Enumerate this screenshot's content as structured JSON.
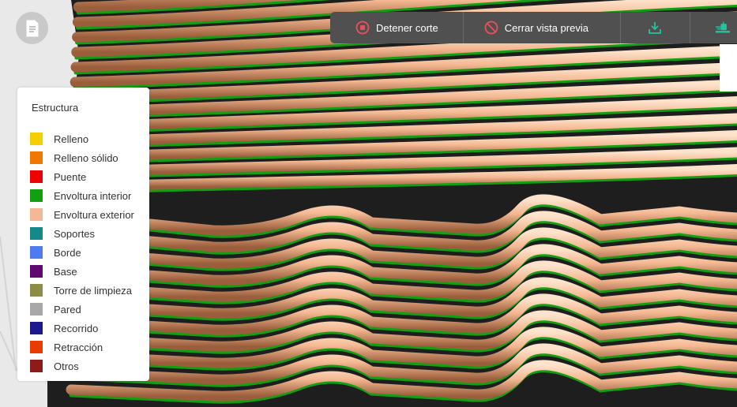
{
  "toolbar": {
    "stop_slice_label": "Detener corte",
    "close_preview_label": "Cerrar vista previa",
    "accent": "#e8505b",
    "download_color": "#25c2a0"
  },
  "legend": {
    "title": "Estructura",
    "items": [
      {
        "label": "Relleno",
        "color": "#f5d000"
      },
      {
        "label": "Relleno sólido",
        "color": "#f07800"
      },
      {
        "label": "Puente",
        "color": "#f00000"
      },
      {
        "label": "Envoltura interior",
        "color": "#12a012"
      },
      {
        "label": "Envoltura exterior",
        "color": "#f5b894"
      },
      {
        "label": "Soportes",
        "color": "#16888c"
      },
      {
        "label": "Borde",
        "color": "#4c7cf0"
      },
      {
        "label": "Base",
        "color": "#5e0a6e"
      },
      {
        "label": "Torre de limpieza",
        "color": "#8c8c46"
      },
      {
        "label": "Pared",
        "color": "#a8a8a8"
      },
      {
        "label": "Recorrido",
        "color": "#1a1a8c"
      },
      {
        "label": "Retracción",
        "color": "#e83c00"
      },
      {
        "label": "Otros",
        "color": "#8c1c1c"
      }
    ]
  }
}
